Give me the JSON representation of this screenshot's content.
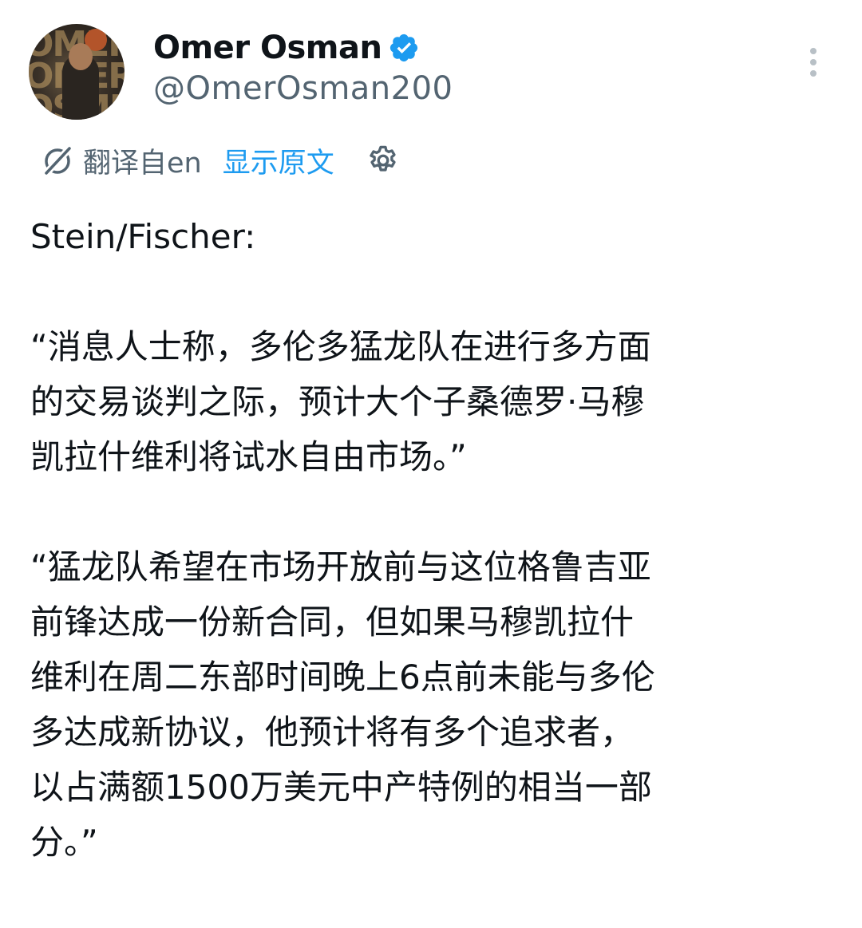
{
  "author": {
    "name": "Omer Osman",
    "handle": "@OmerOsman200",
    "verified": true
  },
  "translation": {
    "from_label": "翻译自en",
    "show_original": "显示原文"
  },
  "tweet": {
    "source": "Stein/Fischer:",
    "quote1": "“消息人士称，多伦多猛龙队在进行多方面\n的交易谈判之际，预计大个子桑德罗·马穆\n凯拉什维利将试水自由市场。”",
    "quote2": "“猛龙队希望在市场开放前与这位格鲁吉亚\n前锋达成一份新合同，但如果马穆凯拉什\n维利在周二东部时间晚上6点前未能与多伦\n多达成新协议，他预计将有多个追求者，\n以占满额1500万美元中产特例的相当一部\n分。”"
  },
  "colors": {
    "accent": "#1d9bf0",
    "secondary_text": "#536471",
    "primary_text": "#0f1419"
  },
  "icons": [
    "verified-badge-icon",
    "more-vertical-icon",
    "translate-icon",
    "gear-icon"
  ]
}
